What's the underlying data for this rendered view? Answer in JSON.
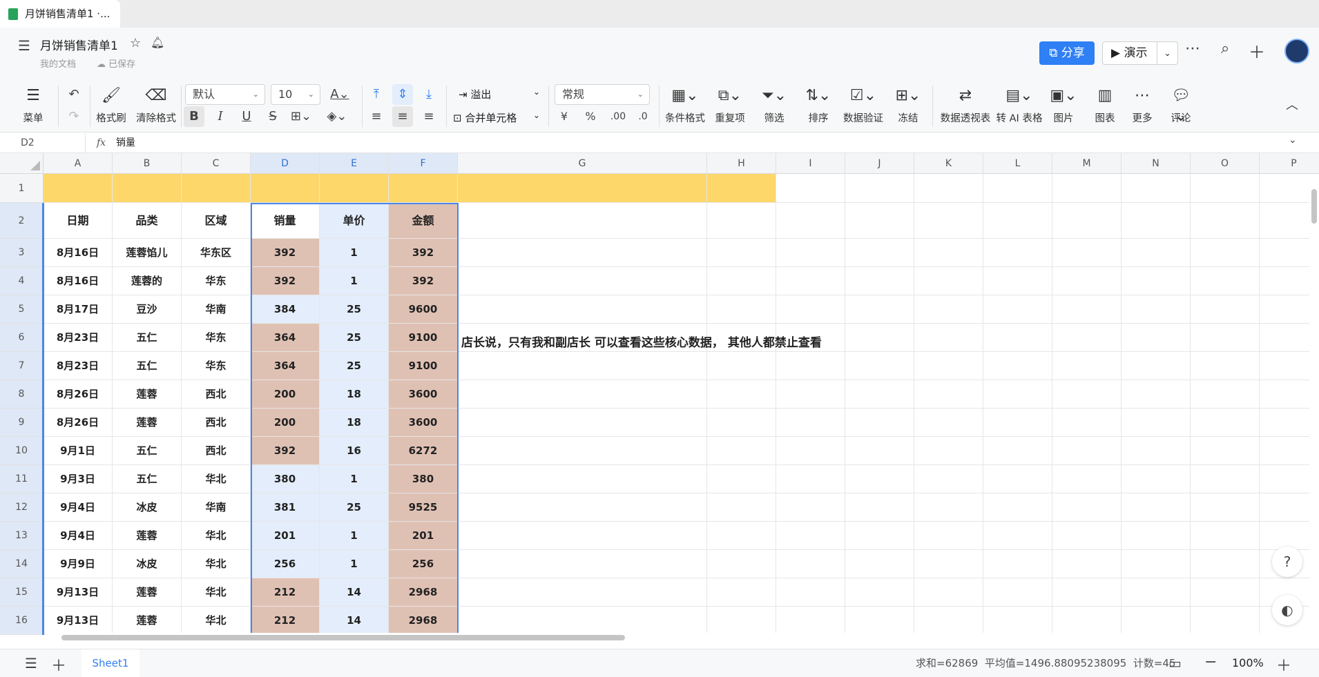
{
  "browser_tab": {
    "title": "月饼销售清单1 ·..."
  },
  "header": {
    "doc_title": "月饼销售清单1",
    "breadcrumb": "我的文档",
    "save_status": "已保存",
    "share_label": "分享",
    "present_label": "演示"
  },
  "toolbar": {
    "menu": "菜单",
    "format_painter": "格式刷",
    "clear_format": "清除格式",
    "font_name": "默认",
    "font_size": "10",
    "overflow": "溢出",
    "merge_cells": "合并单元格",
    "number_format": "常规",
    "conditional_format": "条件格式",
    "duplicates": "重复项",
    "filter": "筛选",
    "sort": "排序",
    "data_validation": "数据验证",
    "freeze": "冻结",
    "pivot": "数据透视表",
    "ai_table": "转 AI 表格",
    "image": "图片",
    "chart": "图表",
    "more": "更多",
    "comment": "评论",
    "currency": "¥",
    "percent": "%",
    "dec_inc": ".00",
    "dec_dec": ".0"
  },
  "formula_bar": {
    "cell_ref": "D2",
    "fx": "fx",
    "value": "销量"
  },
  "columns": [
    "A",
    "B",
    "C",
    "D",
    "E",
    "F",
    "G",
    "H",
    "I",
    "J",
    "K",
    "L",
    "M",
    "N",
    "O",
    "P"
  ],
  "rows": [
    {
      "num": "1",
      "cells": [
        "",
        "",
        "",
        "",
        "",
        ""
      ]
    },
    {
      "num": "2",
      "cells": [
        "日期",
        "品类",
        "区域",
        "销量",
        "单价",
        "金额"
      ]
    },
    {
      "num": "3",
      "cells": [
        "8月16日",
        "莲蓉馅儿",
        "华东区",
        "392",
        "1",
        "392"
      ]
    },
    {
      "num": "4",
      "cells": [
        "8月16日",
        "莲蓉的",
        "华东",
        "392",
        "1",
        "392"
      ]
    },
    {
      "num": "5",
      "cells": [
        "8月17日",
        "豆沙",
        "华南",
        "384",
        "25",
        "9600"
      ]
    },
    {
      "num": "6",
      "cells": [
        "8月23日",
        "五仁",
        "华东",
        "364",
        "25",
        "9100"
      ]
    },
    {
      "num": "7",
      "cells": [
        "8月23日",
        "五仁",
        "华东",
        "364",
        "25",
        "9100"
      ]
    },
    {
      "num": "8",
      "cells": [
        "8月26日",
        "莲蓉",
        "西北",
        "200",
        "18",
        "3600"
      ]
    },
    {
      "num": "9",
      "cells": [
        "8月26日",
        "莲蓉",
        "西北",
        "200",
        "18",
        "3600"
      ]
    },
    {
      "num": "10",
      "cells": [
        "9月1日",
        "五仁",
        "西北",
        "392",
        "16",
        "6272"
      ]
    },
    {
      "num": "11",
      "cells": [
        "9月3日",
        "五仁",
        "华北",
        "380",
        "1",
        "380"
      ]
    },
    {
      "num": "12",
      "cells": [
        "9月4日",
        "冰皮",
        "华南",
        "381",
        "25",
        "9525"
      ]
    },
    {
      "num": "13",
      "cells": [
        "9月4日",
        "莲蓉",
        "华北",
        "201",
        "1",
        "201"
      ]
    },
    {
      "num": "14",
      "cells": [
        "9月9日",
        "冰皮",
        "华北",
        "256",
        "1",
        "256"
      ]
    },
    {
      "num": "15",
      "cells": [
        "9月13日",
        "莲蓉",
        "华北",
        "212",
        "14",
        "2968"
      ]
    },
    {
      "num": "16",
      "cells": [
        "9月13日",
        "莲蓉",
        "华北",
        "212",
        "14",
        "2968"
      ]
    }
  ],
  "note_text": "店长说，只有我和副店长 可以查看这些核心数据， 其他人都禁止查看",
  "colors": {
    "accent": "#2f7ff5",
    "header_yellow": "#fdd76a",
    "highlight_pink": "#dfc1b4",
    "select_blue": "#e3edfb",
    "selection_border": "#4a86e8"
  },
  "status": {
    "sheet_name": "Sheet1",
    "summary": "求和=62869  平均值=1496.88095238095  计数=45",
    "zoom": "100%"
  }
}
